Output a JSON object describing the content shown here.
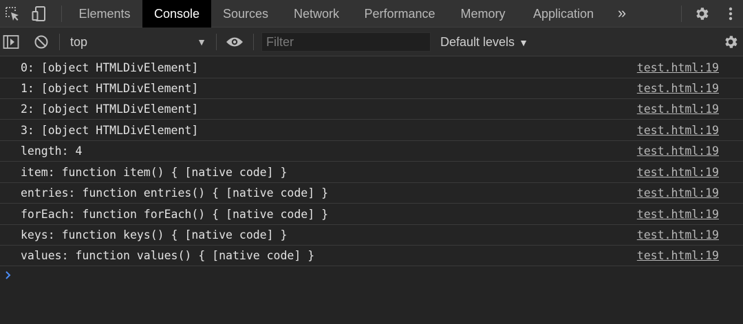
{
  "tabs": [
    {
      "label": "Elements"
    },
    {
      "label": "Console"
    },
    {
      "label": "Sources"
    },
    {
      "label": "Network"
    },
    {
      "label": "Performance"
    },
    {
      "label": "Memory"
    },
    {
      "label": "Application"
    }
  ],
  "active_tab": "Console",
  "more_tabs_label": "»",
  "toolbar": {
    "context": "top",
    "filter_placeholder": "Filter",
    "filter_value": "",
    "levels": "Default levels"
  },
  "console": {
    "rows": [
      {
        "text": "0: [object HTMLDivElement]",
        "source": "test.html:19"
      },
      {
        "text": "1: [object HTMLDivElement]",
        "source": "test.html:19"
      },
      {
        "text": "2: [object HTMLDivElement]",
        "source": "test.html:19"
      },
      {
        "text": "3: [object HTMLDivElement]",
        "source": "test.html:19"
      },
      {
        "text": "length: 4",
        "source": "test.html:19"
      },
      {
        "text": "item: function item() { [native code] }",
        "source": "test.html:19"
      },
      {
        "text": "entries: function entries() { [native code] }",
        "source": "test.html:19"
      },
      {
        "text": "forEach: function forEach() { [native code] }",
        "source": "test.html:19"
      },
      {
        "text": "keys: function keys() { [native code] }",
        "source": "test.html:19"
      },
      {
        "text": "values: function values() { [native code] }",
        "source": "test.html:19"
      }
    ]
  },
  "icons": {
    "inspect": "inspect-element-icon",
    "device": "device-toolbar-icon",
    "settings": "gear-icon",
    "menu": "kebab-menu-icon",
    "sidebar": "show-sidebar-icon",
    "clear": "clear-console-icon",
    "eye": "live-expression-icon",
    "console_settings": "console-settings-icon",
    "prompt": "prompt-chevron-icon"
  },
  "colors": {
    "active_tab_bg": "#000000",
    "panel_bg": "#242424",
    "prompt": "#4c8df6"
  }
}
